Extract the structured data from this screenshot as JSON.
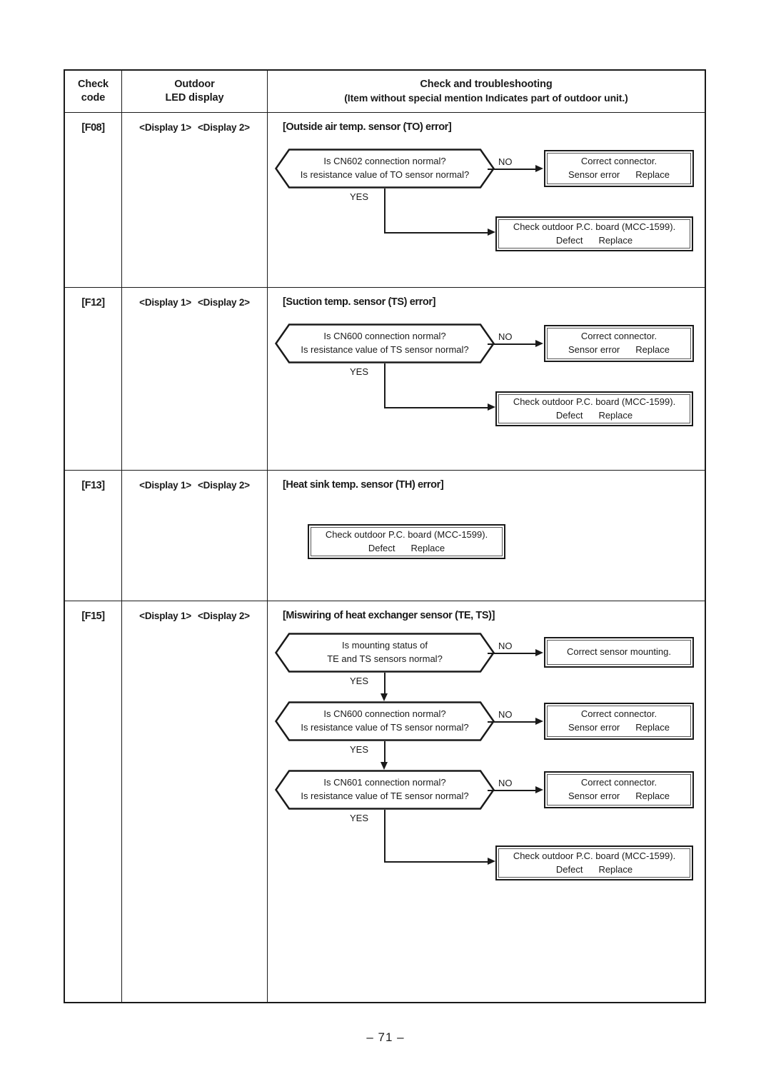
{
  "page": {
    "number": "– 71 –"
  },
  "table": {
    "headers": {
      "check_code": [
        "Check",
        "code"
      ],
      "outdoor_led": [
        "Outdoor",
        "LED display"
      ],
      "check_trouble": "Check and troubleshooting",
      "check_trouble_sub": "(Item without special mention Indicates part of outdoor unit.)"
    },
    "display_labels": {
      "display1": "<Display 1>",
      "display2": "<Display 2>"
    },
    "rows": [
      {
        "code": "[F08]",
        "title": "[Outside air temp. sensor (TO) error]",
        "flow": {
          "decision": {
            "line1": "Is CN602 connection normal?",
            "line2": "Is resistance value of TO sensor normal?",
            "no_label": "NO",
            "yes_label": "YES"
          },
          "no_box": {
            "line1": "Correct connector.",
            "line2a": "Sensor error",
            "line2b": "Replace"
          },
          "yes_box": {
            "line1": "Check outdoor P.C. board (MCC-1599).",
            "line2a": "Defect",
            "line2b": "Replace"
          }
        }
      },
      {
        "code": "[F12]",
        "title": "[Suction temp. sensor (TS) error]",
        "flow": {
          "decision": {
            "line1": "Is CN600 connection normal?",
            "line2": "Is resistance value of TS sensor normal?",
            "no_label": "NO",
            "yes_label": "YES"
          },
          "no_box": {
            "line1": "Correct connector.",
            "line2a": "Sensor error",
            "line2b": "Replace"
          },
          "yes_box": {
            "line1": "Check outdoor P.C. board (MCC-1599).",
            "line2a": "Defect",
            "line2b": "Replace"
          }
        }
      },
      {
        "code": "[F13]",
        "title": "[Heat sink temp. sensor (TH) error]",
        "flow": {
          "box": {
            "line1": "Check outdoor P.C. board (MCC-1599).",
            "line2a": "Defect",
            "line2b": "Replace"
          }
        }
      },
      {
        "code": "[F15]",
        "title": "[Miswiring of heat exchanger sensor (TE, TS)]",
        "flow": {
          "decision1": {
            "line1": "Is mounting status of",
            "line2": "TE and TS sensors normal?",
            "no_label": "NO",
            "yes_label": "YES"
          },
          "no_box1": {
            "line1": "Correct sensor mounting."
          },
          "decision2": {
            "line1": "Is CN600 connection normal?",
            "line2": "Is resistance value of TS sensor normal?",
            "no_label": "NO",
            "yes_label": "YES"
          },
          "no_box2": {
            "line1": "Correct connector.",
            "line2a": "Sensor error",
            "line2b": "Replace"
          },
          "decision3": {
            "line1": "Is CN601 connection normal?",
            "line2": "Is resistance value of TE sensor normal?",
            "no_label": "NO",
            "yes_label": "YES"
          },
          "no_box3": {
            "line1": "Correct connector.",
            "line2a": "Sensor error",
            "line2b": "Replace"
          },
          "final_box": {
            "line1": "Check outdoor P.C. board (MCC-1599).",
            "line2a": "Defect",
            "line2b": "Replace"
          }
        }
      }
    ]
  }
}
